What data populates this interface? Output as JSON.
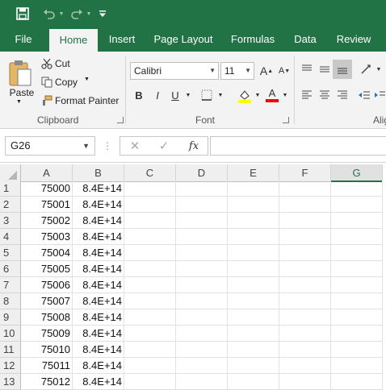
{
  "quick_access": {
    "save_icon": "save-icon",
    "undo_icon": "undo-icon",
    "redo_icon": "redo-icon",
    "customize_icon": "customize-qat-icon"
  },
  "tabs": [
    "File",
    "Home",
    "Insert",
    "Page Layout",
    "Formulas",
    "Data",
    "Review"
  ],
  "active_tab": "Home",
  "clipboard": {
    "paste": "Paste",
    "cut": "Cut",
    "copy": "Copy",
    "format_painter": "Format Painter",
    "label": "Clipboard"
  },
  "font": {
    "name": "Calibri",
    "size": "11",
    "bold": "B",
    "italic": "I",
    "underline": "U",
    "font_color_letter": "A",
    "label": "Font"
  },
  "alignment": {
    "label": "Aligi"
  },
  "formula_bar": {
    "name_box": "G26",
    "fx": "fx",
    "formula": ""
  },
  "columns": [
    "A",
    "B",
    "C",
    "D",
    "E",
    "F",
    "G"
  ],
  "selected_column": "G",
  "rows": [
    {
      "n": "1",
      "a": "75000",
      "b": "8.4E+14"
    },
    {
      "n": "2",
      "a": "75001",
      "b": "8.4E+14"
    },
    {
      "n": "3",
      "a": "75002",
      "b": "8.4E+14"
    },
    {
      "n": "4",
      "a": "75003",
      "b": "8.4E+14"
    },
    {
      "n": "5",
      "a": "75004",
      "b": "8.4E+14"
    },
    {
      "n": "6",
      "a": "75005",
      "b": "8.4E+14"
    },
    {
      "n": "7",
      "a": "75006",
      "b": "8.4E+14"
    },
    {
      "n": "8",
      "a": "75007",
      "b": "8.4E+14"
    },
    {
      "n": "9",
      "a": "75008",
      "b": "8.4E+14"
    },
    {
      "n": "10",
      "a": "75009",
      "b": "8.4E+14"
    },
    {
      "n": "11",
      "a": "75010",
      "b": "8.4E+14"
    },
    {
      "n": "12",
      "a": "75011",
      "b": "8.4E+14"
    },
    {
      "n": "13",
      "a": "75012",
      "b": "8.4E+14"
    }
  ],
  "colors": {
    "brand_green": "#217346",
    "highlight_yellow": "#ffff00",
    "font_red": "#ff0000"
  }
}
